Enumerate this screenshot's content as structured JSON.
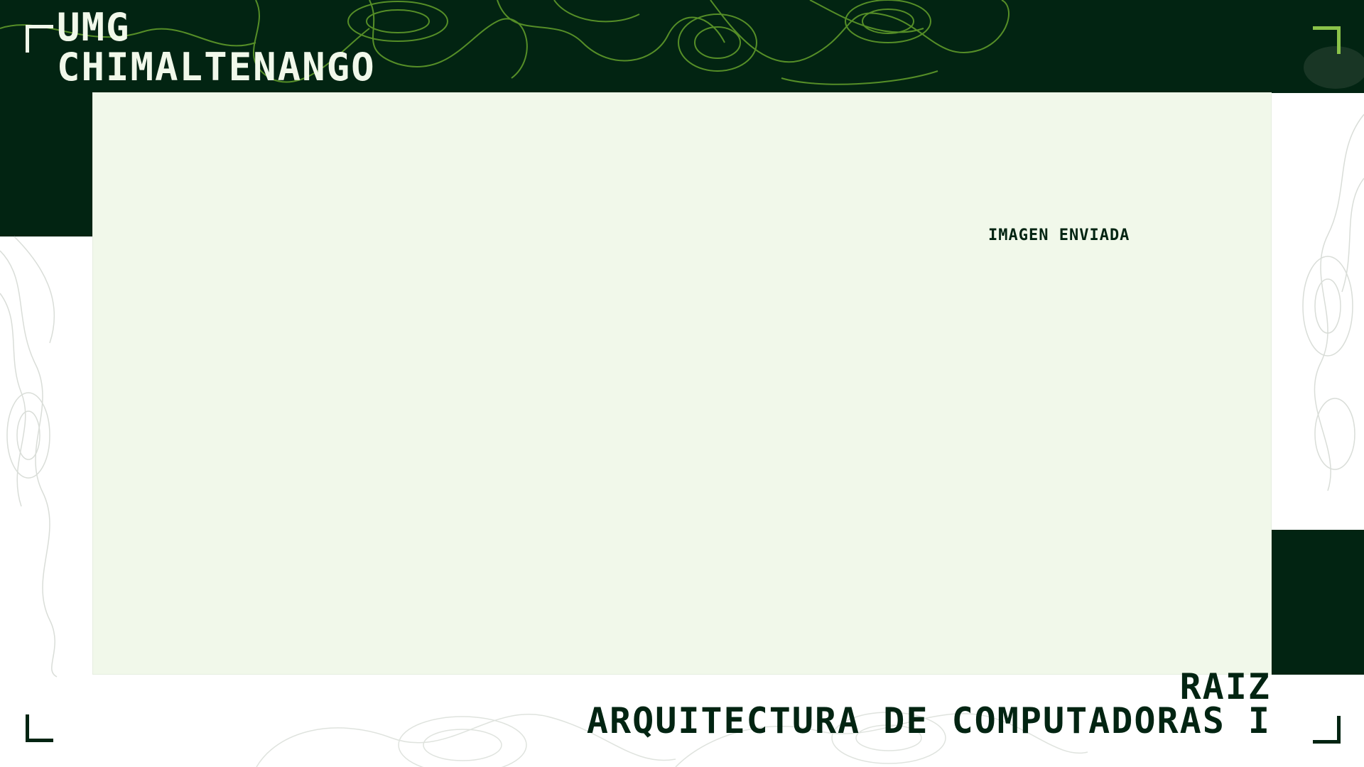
{
  "brand": {
    "line1": "UMG",
    "line2": "CHIMALTENANGO"
  },
  "panel": {
    "caption": "IMAGEN ENVIADA"
  },
  "course": {
    "line1": "RAIZ",
    "line2": "ARQUITECTURA DE COMPUTADORAS I"
  },
  "colors": {
    "dark_green": "#022412",
    "accent_green": "#8bc34a",
    "panel_bg": "#f1f8ea",
    "background": "#ffffff"
  }
}
